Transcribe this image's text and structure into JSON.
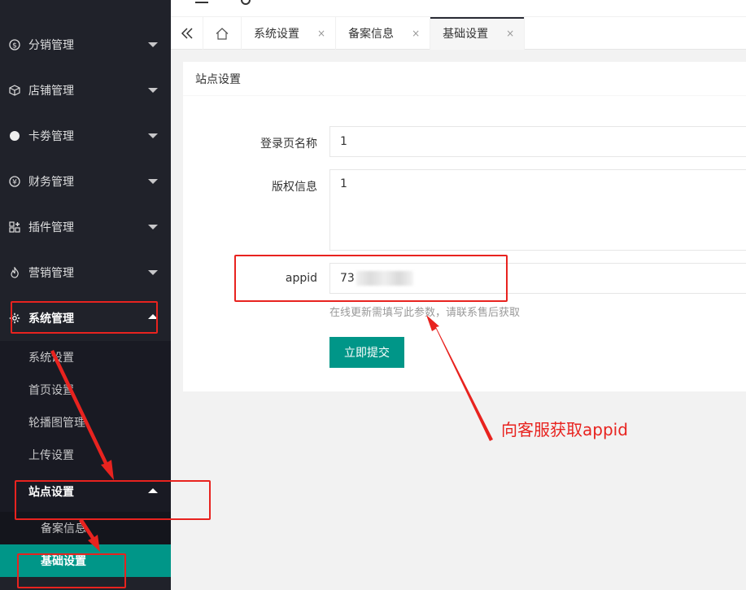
{
  "sidebar": {
    "menu": [
      {
        "label": "分销管理",
        "icon": "dollar-circle-icon"
      },
      {
        "label": "店铺管理",
        "icon": "cube-icon"
      },
      {
        "label": "卡劵管理",
        "icon": "dot-circle-icon"
      },
      {
        "label": "财务管理",
        "icon": "yen-circle-icon"
      },
      {
        "label": "插件管理",
        "icon": "grid-plus-icon"
      },
      {
        "label": "营销管理",
        "icon": "fire-icon"
      },
      {
        "label": "系统管理",
        "icon": "gear-icon"
      }
    ],
    "system_submenu": [
      "系统设置",
      "首页设置",
      "轮播图管理",
      "上传设置"
    ],
    "site_settings": {
      "label": "站点设置",
      "children": [
        "备案信息",
        "基础设置"
      ]
    }
  },
  "tabs": {
    "items": [
      {
        "label": "系统设置"
      },
      {
        "label": "备案信息"
      },
      {
        "label": "基础设置",
        "active": true
      }
    ],
    "close_glyph": "×"
  },
  "card": {
    "title": "站点设置",
    "fields": {
      "login_name": {
        "label": "登录页名称",
        "value": "1"
      },
      "copyright": {
        "label": "版权信息",
        "value": "1"
      },
      "appid": {
        "label": "appid",
        "value_visible": "73"
      }
    },
    "hint": "在线更新需填写此参数，请联系售后获取",
    "submit_label": "立即提交"
  },
  "annotation": {
    "text": "向客服获取appid",
    "color": "#e8231f"
  },
  "colors": {
    "sidebar_bg": "#20222a",
    "accent": "#009688",
    "annotation_red": "#e8231f"
  }
}
